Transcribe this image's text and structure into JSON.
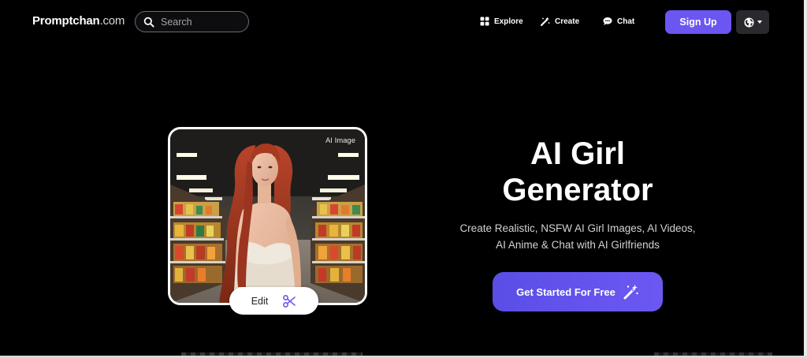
{
  "header": {
    "brand_bold": "Promptchan",
    "brand_light": ".com",
    "search_placeholder": "Search",
    "nav": {
      "explore": "Explore",
      "create": "Create",
      "chat": "Chat"
    },
    "signup_label": "Sign Up"
  },
  "hero": {
    "image_badge": "AI Image",
    "edit_label": "Edit",
    "title": "AI Girl Generator",
    "subtitle": "Create Realistic, NSFW AI Girl Images, AI Videos, AI Anime & Chat with AI Girlfriends",
    "cta_label": "Get Started For Free"
  },
  "colors": {
    "accent": "#6b56f2",
    "background": "#000000"
  }
}
